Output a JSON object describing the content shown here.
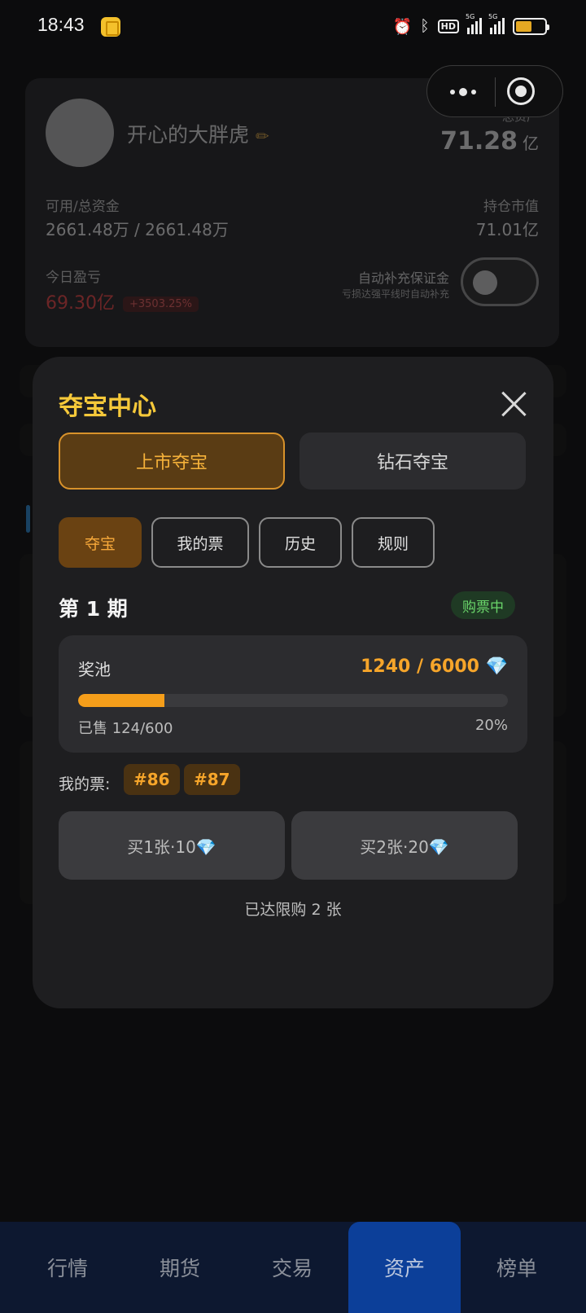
{
  "status_bar": {
    "time": "18:43",
    "icons": [
      "app-notification-icon",
      "alarm-icon",
      "bluetooth-icon",
      "hd-voice-icon",
      "signal-5g-icon",
      "signal-5g-icon",
      "battery-icon"
    ],
    "hd": "HD",
    "net1": "5G",
    "net2": "5G",
    "battery_level": 0.55
  },
  "profile": {
    "username": "开心的大胖虎",
    "total_assets_label": "总资产",
    "total_assets_value": "71.28",
    "total_assets_unit": "亿",
    "available_label": "可用/总资金",
    "available_value": "2661.48万 / 2661.48万",
    "holdings_label": "持仓市值",
    "holdings_value": "71.01亿",
    "pnl_label": "今日盈亏",
    "pnl_value": "69.30亿",
    "pnl_percent": "+3503.25%",
    "auto_margin_label": "自动补充保证金",
    "auto_margin_sub": "亏损达强平线时自动补充",
    "auto_margin_on": false
  },
  "modal": {
    "title": "夺宝中心",
    "segments": [
      {
        "label": "上市夺宝",
        "active": true
      },
      {
        "label": "钻石夺宝",
        "active": false
      }
    ],
    "chips": [
      {
        "label": "夺宝",
        "active": true
      },
      {
        "label": "我的票",
        "active": false
      },
      {
        "label": "历史",
        "active": false
      },
      {
        "label": "规则",
        "active": false
      }
    ],
    "period": "第 1 期",
    "status": "购票中",
    "pool": {
      "label": "奖池",
      "value": "1240 / 6000 💎",
      "progress": 0.2,
      "sold": "已售 124/600",
      "percent": "20%"
    },
    "my_tickets_label": "我的票:",
    "tickets": [
      "#86",
      "#87"
    ],
    "buy_buttons": [
      "买1张·10💎",
      "买2张·20💎"
    ],
    "limit_note": "已达限购 2 张"
  },
  "bottom_nav": {
    "items": [
      {
        "label": "行情",
        "active": false
      },
      {
        "label": "期货",
        "active": false
      },
      {
        "label": "交易",
        "active": false
      },
      {
        "label": "资产",
        "active": true
      },
      {
        "label": "榜单",
        "active": false
      }
    ]
  },
  "colors": {
    "accent_gold": "#f6c93a",
    "accent_orange": "#f6a52a",
    "active_nav": "#0c3f99",
    "loss_red": "#f24b4b",
    "badge_green": "#6ad56a"
  }
}
